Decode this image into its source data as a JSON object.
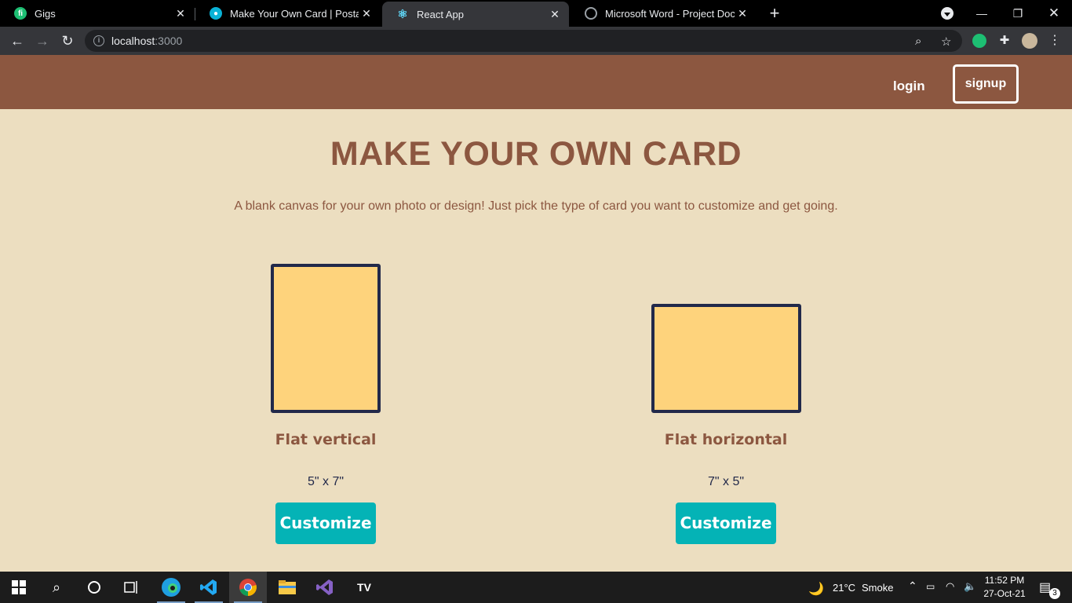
{
  "browser": {
    "tabs": [
      {
        "title": "Gigs",
        "icon": "fiverr-icon",
        "color": "#1dbf73"
      },
      {
        "title": "Make Your Own Card | Postable",
        "icon": "postable-icon",
        "color": "#0ab2d6"
      },
      {
        "title": "React App",
        "icon": "react-icon",
        "color": "#61dafb"
      },
      {
        "title": "Microsoft Word - Project Docum",
        "icon": "globe-icon",
        "color": "#9aa0a6"
      }
    ],
    "address": {
      "host": "localhost",
      "port": ":3000"
    }
  },
  "header": {
    "login_label": "login",
    "signup_label": "signup",
    "background": "#8c5740"
  },
  "hero": {
    "title": "MAKE YOUR OWN CARD",
    "subtitle": "A blank canvas for your own photo or design! Just pick the type of card you want to customize and get going."
  },
  "cards": [
    {
      "title": "Flat vertical",
      "size": "5\" x 7\"",
      "button": "Customize"
    },
    {
      "title": "Flat horizontal",
      "size": "7\" x 5\"",
      "button": "Customize"
    }
  ],
  "colors": {
    "page_bg": "#ecdec0",
    "card_fill": "#fed37c",
    "card_border": "#22294a",
    "accent": "#04b3b6"
  },
  "taskbar": {
    "weather": {
      "temp": "21°C",
      "condition": "Smoke"
    },
    "time": "11:52 PM",
    "date": "27-Oct-21",
    "notification_count": "3"
  }
}
